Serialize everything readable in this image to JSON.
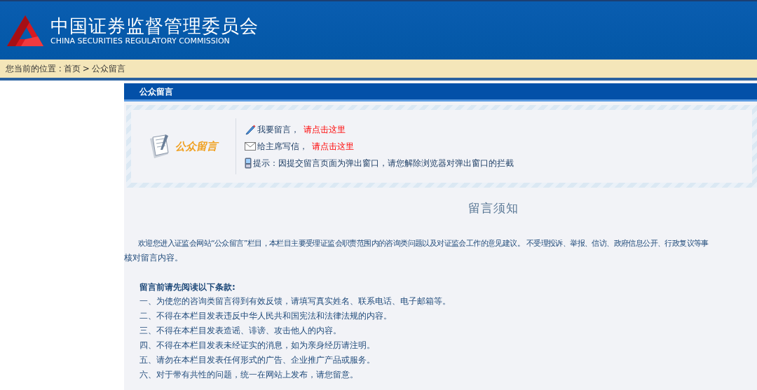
{
  "header": {
    "title": "中国证券监督管理委员会",
    "subtitle": "CHINA SECURITIES REGULATORY COMMISSION"
  },
  "breadcrumb": {
    "label": "您当前的位置 :",
    "items": [
      "首页",
      ">",
      "公众留言"
    ]
  },
  "section": {
    "title": "公众留言"
  },
  "intro_box": {
    "logo_label": "公众留言",
    "lines": [
      {
        "kind": "pencil",
        "text": "我要留言，",
        "link": "请点击这里"
      },
      {
        "kind": "mail",
        "text": "给主席写信，",
        "link": "请点击这里"
      },
      {
        "kind": "phone",
        "text": "提示：因提交留言页面为弹出窗口，请您解除浏览器对弹出窗口的拦截"
      }
    ]
  },
  "notice": {
    "heading": "留言须知",
    "paragraph_lines": [
      "欢迎您进入证监会网站“公众留言”栏目，本栏目主要受理证监会职责范围内的咨询类问题以及对证监会工作的意见建议。 不受理投诉、举报、信访、政府信息公开、行政复议等事",
      "核对留言内容。"
    ],
    "terms_heading": "留言前请先阅读以下条款:",
    "terms": [
      "一、为使您的咨询类留言得到有效反馈，请填写真实姓名、联系电话、电子邮箱等。",
      "二、不得在本栏目发表违反中华人民共和国宪法和法律法规的内容。",
      "三、不得在本栏目发表造谣、诽谤、攻击他人的内容。",
      "四、不得在本栏目发表未经证实的消息，如为亲身经历请注明。",
      "五、请勿在本栏目发表任何形式的广告、企业推广产品或服务。",
      "六、对于带有共性的问题，统一在网站上发布，请您留意。"
    ]
  }
}
